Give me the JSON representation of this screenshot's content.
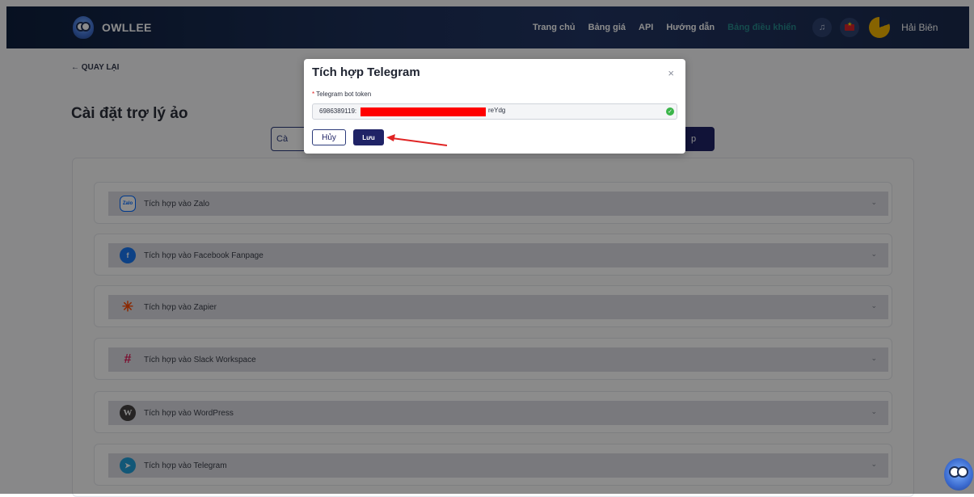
{
  "header": {
    "brand": "OWLLEE",
    "nav": [
      "Trang chủ",
      "Bảng giá",
      "API",
      "Hướng dẫn"
    ],
    "nav_active": "Bảng điều khiển",
    "user_name": "Hải Biên"
  },
  "page": {
    "back_label": "← QUAY LẠI",
    "title": "Cài đặt trợ lý ảo",
    "tab_left_fragment": "Cà",
    "tab_right_fragment": "p"
  },
  "integrations": [
    {
      "label": "Tích hợp vào Zalo",
      "icon": "zalo-icon",
      "icon_text": "Zalo",
      "color": "#0068ff"
    },
    {
      "label": "Tích hợp vào Facebook Fanpage",
      "icon": "facebook-icon",
      "icon_text": "f",
      "color": "#1877f2"
    },
    {
      "label": "Tích hợp vào Zapier",
      "icon": "zapier-icon",
      "icon_text": "✳",
      "color": "#ff4a00"
    },
    {
      "label": "Tích hợp vào Slack Workspace",
      "icon": "slack-icon",
      "icon_text": "#",
      "color": "#4a154b"
    },
    {
      "label": "Tích hợp vào WordPress",
      "icon": "wordpress-icon",
      "icon_text": "W",
      "color": "#21759b"
    },
    {
      "label": "Tích hợp vào Telegram",
      "icon": "telegram-icon",
      "icon_text": "➤",
      "color": "#229ed9"
    }
  ],
  "modal": {
    "title": "Tích hợp Telegram",
    "close": "×",
    "field_required_mark": "*",
    "field_label": "Telegram bot token",
    "token_prefix": "6986389119:",
    "token_suffix": "reYdg",
    "cancel_label": "Hủy",
    "save_label": "Lưu"
  },
  "colors": {
    "primary": "#1f2366",
    "nav_bg": "#1c2f57",
    "valid": "#3bb54a",
    "annotation": "#e02424"
  }
}
